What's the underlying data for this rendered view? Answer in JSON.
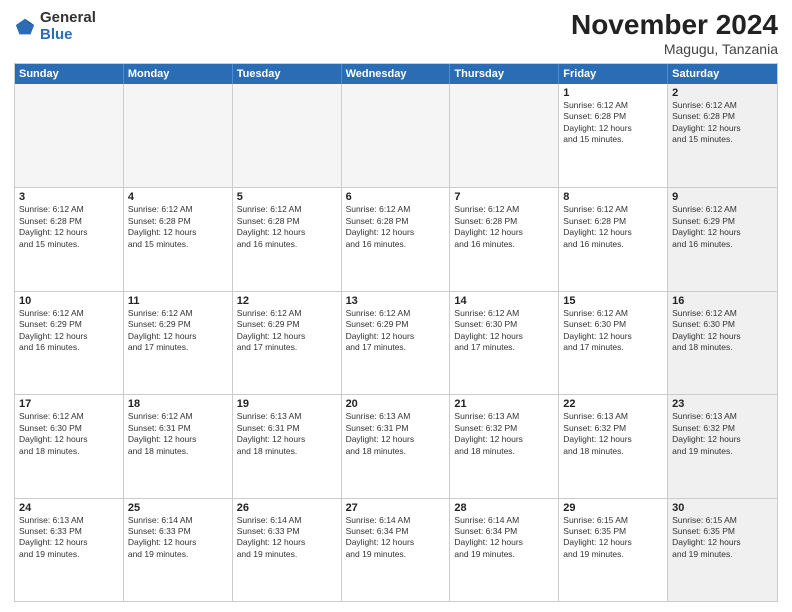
{
  "logo": {
    "general": "General",
    "blue": "Blue"
  },
  "title": "November 2024",
  "subtitle": "Magugu, Tanzania",
  "days": [
    "Sunday",
    "Monday",
    "Tuesday",
    "Wednesday",
    "Thursday",
    "Friday",
    "Saturday"
  ],
  "weeks": [
    [
      {
        "num": "",
        "info": "",
        "empty": true
      },
      {
        "num": "",
        "info": "",
        "empty": true
      },
      {
        "num": "",
        "info": "",
        "empty": true
      },
      {
        "num": "",
        "info": "",
        "empty": true
      },
      {
        "num": "",
        "info": "",
        "empty": true
      },
      {
        "num": "1",
        "info": "Sunrise: 6:12 AM\nSunset: 6:28 PM\nDaylight: 12 hours\nand 15 minutes."
      },
      {
        "num": "2",
        "info": "Sunrise: 6:12 AM\nSunset: 6:28 PM\nDaylight: 12 hours\nand 15 minutes.",
        "shaded": true
      }
    ],
    [
      {
        "num": "3",
        "info": "Sunrise: 6:12 AM\nSunset: 6:28 PM\nDaylight: 12 hours\nand 15 minutes."
      },
      {
        "num": "4",
        "info": "Sunrise: 6:12 AM\nSunset: 6:28 PM\nDaylight: 12 hours\nand 15 minutes."
      },
      {
        "num": "5",
        "info": "Sunrise: 6:12 AM\nSunset: 6:28 PM\nDaylight: 12 hours\nand 16 minutes."
      },
      {
        "num": "6",
        "info": "Sunrise: 6:12 AM\nSunset: 6:28 PM\nDaylight: 12 hours\nand 16 minutes."
      },
      {
        "num": "7",
        "info": "Sunrise: 6:12 AM\nSunset: 6:28 PM\nDaylight: 12 hours\nand 16 minutes."
      },
      {
        "num": "8",
        "info": "Sunrise: 6:12 AM\nSunset: 6:28 PM\nDaylight: 12 hours\nand 16 minutes."
      },
      {
        "num": "9",
        "info": "Sunrise: 6:12 AM\nSunset: 6:29 PM\nDaylight: 12 hours\nand 16 minutes.",
        "shaded": true
      }
    ],
    [
      {
        "num": "10",
        "info": "Sunrise: 6:12 AM\nSunset: 6:29 PM\nDaylight: 12 hours\nand 16 minutes."
      },
      {
        "num": "11",
        "info": "Sunrise: 6:12 AM\nSunset: 6:29 PM\nDaylight: 12 hours\nand 17 minutes."
      },
      {
        "num": "12",
        "info": "Sunrise: 6:12 AM\nSunset: 6:29 PM\nDaylight: 12 hours\nand 17 minutes."
      },
      {
        "num": "13",
        "info": "Sunrise: 6:12 AM\nSunset: 6:29 PM\nDaylight: 12 hours\nand 17 minutes."
      },
      {
        "num": "14",
        "info": "Sunrise: 6:12 AM\nSunset: 6:30 PM\nDaylight: 12 hours\nand 17 minutes."
      },
      {
        "num": "15",
        "info": "Sunrise: 6:12 AM\nSunset: 6:30 PM\nDaylight: 12 hours\nand 17 minutes."
      },
      {
        "num": "16",
        "info": "Sunrise: 6:12 AM\nSunset: 6:30 PM\nDaylight: 12 hours\nand 18 minutes.",
        "shaded": true
      }
    ],
    [
      {
        "num": "17",
        "info": "Sunrise: 6:12 AM\nSunset: 6:30 PM\nDaylight: 12 hours\nand 18 minutes."
      },
      {
        "num": "18",
        "info": "Sunrise: 6:12 AM\nSunset: 6:31 PM\nDaylight: 12 hours\nand 18 minutes."
      },
      {
        "num": "19",
        "info": "Sunrise: 6:13 AM\nSunset: 6:31 PM\nDaylight: 12 hours\nand 18 minutes."
      },
      {
        "num": "20",
        "info": "Sunrise: 6:13 AM\nSunset: 6:31 PM\nDaylight: 12 hours\nand 18 minutes."
      },
      {
        "num": "21",
        "info": "Sunrise: 6:13 AM\nSunset: 6:32 PM\nDaylight: 12 hours\nand 18 minutes."
      },
      {
        "num": "22",
        "info": "Sunrise: 6:13 AM\nSunset: 6:32 PM\nDaylight: 12 hours\nand 18 minutes."
      },
      {
        "num": "23",
        "info": "Sunrise: 6:13 AM\nSunset: 6:32 PM\nDaylight: 12 hours\nand 19 minutes.",
        "shaded": true
      }
    ],
    [
      {
        "num": "24",
        "info": "Sunrise: 6:13 AM\nSunset: 6:33 PM\nDaylight: 12 hours\nand 19 minutes."
      },
      {
        "num": "25",
        "info": "Sunrise: 6:14 AM\nSunset: 6:33 PM\nDaylight: 12 hours\nand 19 minutes."
      },
      {
        "num": "26",
        "info": "Sunrise: 6:14 AM\nSunset: 6:33 PM\nDaylight: 12 hours\nand 19 minutes."
      },
      {
        "num": "27",
        "info": "Sunrise: 6:14 AM\nSunset: 6:34 PM\nDaylight: 12 hours\nand 19 minutes."
      },
      {
        "num": "28",
        "info": "Sunrise: 6:14 AM\nSunset: 6:34 PM\nDaylight: 12 hours\nand 19 minutes."
      },
      {
        "num": "29",
        "info": "Sunrise: 6:15 AM\nSunset: 6:35 PM\nDaylight: 12 hours\nand 19 minutes."
      },
      {
        "num": "30",
        "info": "Sunrise: 6:15 AM\nSunset: 6:35 PM\nDaylight: 12 hours\nand 19 minutes.",
        "shaded": true
      }
    ]
  ]
}
